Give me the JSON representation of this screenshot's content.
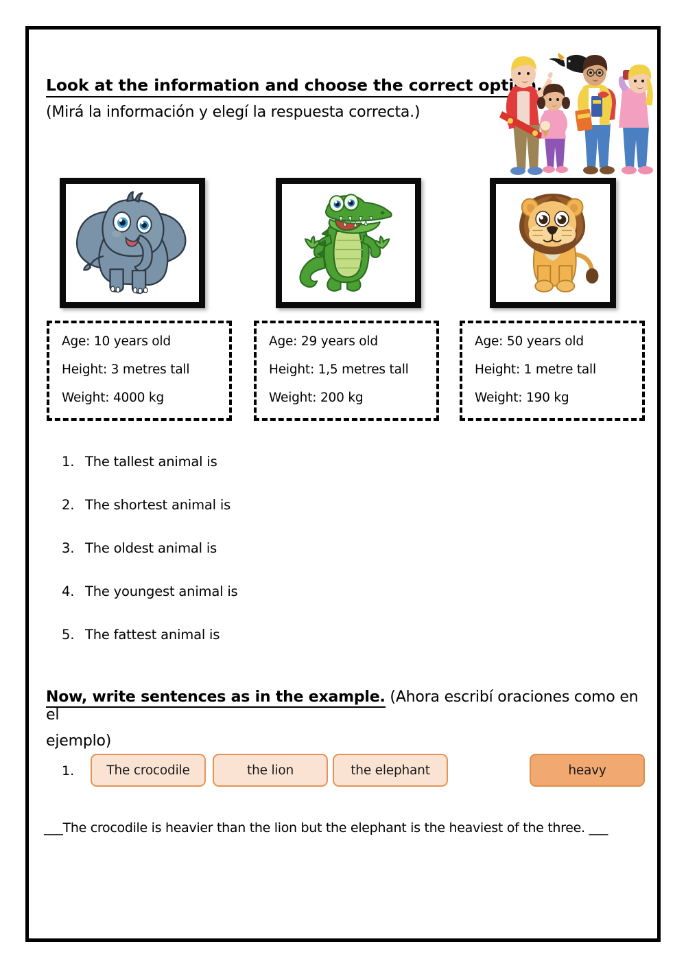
{
  "section1": {
    "heading_en": "Look at the information and choose the correct option.",
    "heading_es": "(Mirá la información y elegí la respuesta correcta.)"
  },
  "clipart": {
    "name": "kids-watching-bird-illustration",
    "description": "Group of four children outdoors looking up at a flying toucan bird"
  },
  "animals": [
    {
      "id": "elephant",
      "image_name": "cartoon-elephant-photo",
      "age": "Age: 10 years old",
      "height": "Height: 3 metres tall",
      "weight": "Weight: 4000 kg"
    },
    {
      "id": "crocodile",
      "image_name": "cartoon-crocodile-photo",
      "age": "Age: 29 years old",
      "height": "Height: 1,5 metres tall",
      "weight": "Weight: 200 kg"
    },
    {
      "id": "lion",
      "image_name": "cartoon-lion-photo",
      "age": "Age: 50 years old",
      "height": "Height: 1 metre tall",
      "weight": "Weight: 190 kg"
    }
  ],
  "questions": [
    {
      "num": "1.",
      "text": "The tallest animal is"
    },
    {
      "num": "2.",
      "text": "The shortest animal is"
    },
    {
      "num": "3.",
      "text": "The oldest animal is"
    },
    {
      "num": "4.",
      "text": "The youngest animal is"
    },
    {
      "num": "5.",
      "text": "The fattest animal is"
    }
  ],
  "section2": {
    "heading_en": "Now, write sentences as in the example.",
    "heading_es_part1": " (Ahora escribí oraciones como en el",
    "heading_es_part2": "ejemplo)",
    "item_number": "1.",
    "tiles": [
      {
        "label": "The crocodile",
        "style": "light"
      },
      {
        "label": "the lion",
        "style": "light"
      },
      {
        "label": "the elephant",
        "style": "light"
      },
      {
        "label": "heavy",
        "style": "dark"
      }
    ],
    "answer_sentence": "___The crocodile is heavier than the lion but the elephant is the heaviest of the three. ___"
  },
  "colors": {
    "tile_light_bg": "#fbe3d3",
    "tile_light_border": "#e49257",
    "tile_dark_bg": "#f2a971",
    "tile_dark_border": "#dd8e4d",
    "page_border": "#000000",
    "frame_border": "#0b0b0b"
  }
}
